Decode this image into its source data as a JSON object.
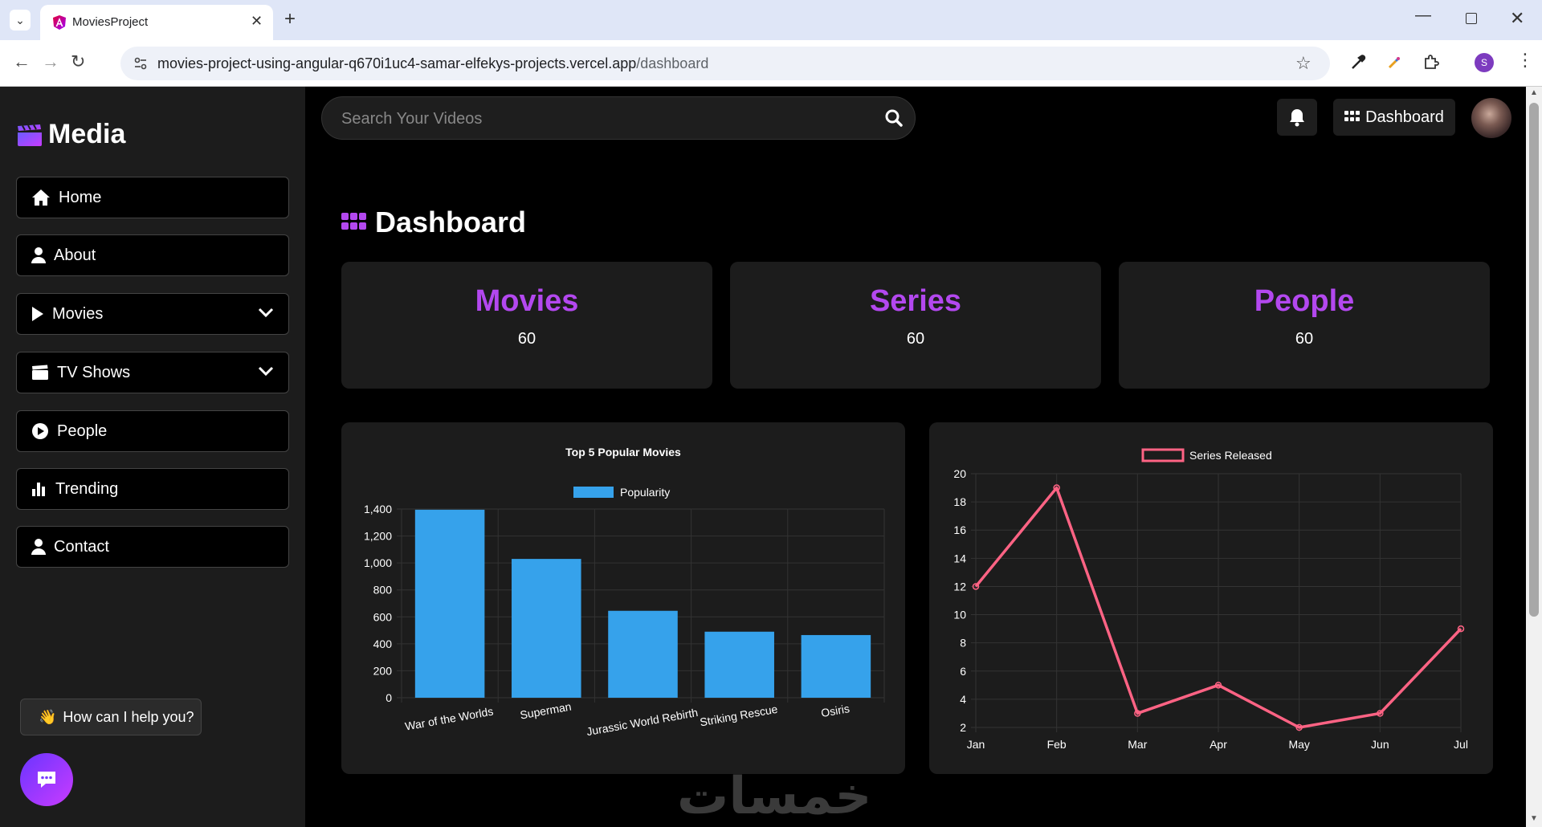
{
  "browser": {
    "tab_title": "MoviesProject",
    "url_host": "movies-project-using-angular-q670i1uc4-samar-elfekys-projects.vercel.app",
    "url_path": "/dashboard",
    "profile_initial": "S"
  },
  "sidebar": {
    "brand": "Media",
    "items": [
      {
        "label": "Home",
        "icon": "home-icon"
      },
      {
        "label": "About",
        "icon": "user-icon"
      },
      {
        "label": "Movies",
        "icon": "play-icon",
        "dropdown": true
      },
      {
        "label": "TV Shows",
        "icon": "clapperboard-icon",
        "dropdown": true
      },
      {
        "label": "People",
        "icon": "play-circle-icon"
      },
      {
        "label": "Trending",
        "icon": "bar-chart-icon"
      },
      {
        "label": "Contact",
        "icon": "user-icon"
      }
    ],
    "help_text": "How can I help you?",
    "help_emoji": "👋"
  },
  "header": {
    "search_placeholder": "Search Your Videos",
    "dashboard_label": "Dashboard"
  },
  "page": {
    "title": "Dashboard"
  },
  "stats": [
    {
      "label": "Movies",
      "value": "60"
    },
    {
      "label": "Series",
      "value": "60"
    },
    {
      "label": "People",
      "value": "60"
    }
  ],
  "colors": {
    "accent": "#b348ef",
    "bar": "#36a2eb",
    "line": "#ff6384"
  },
  "chart_data": [
    {
      "type": "bar",
      "title": "Top 5 Popular Movies",
      "categories": [
        "War of the Worlds",
        "Superman",
        "Jurassic World Rebirth",
        "Striking Rescue",
        "Osiris"
      ],
      "series": [
        {
          "name": "Popularity",
          "values": [
            1395,
            1030,
            645,
            490,
            465
          ]
        }
      ],
      "ylim": [
        0,
        1400
      ],
      "yticks": [
        "0",
        "200",
        "400",
        "600",
        "800",
        "1,000",
        "1,200",
        "1,400"
      ],
      "legend": "top",
      "grid": true
    },
    {
      "type": "line",
      "x": [
        "Jan",
        "Feb",
        "Mar",
        "Apr",
        "May",
        "Jun",
        "Jul"
      ],
      "series": [
        {
          "name": "Series Released",
          "values": [
            12,
            19,
            3,
            5,
            2,
            3,
            9
          ]
        }
      ],
      "ylim": [
        2,
        20
      ],
      "yticks": [
        "2",
        "4",
        "6",
        "8",
        "10",
        "12",
        "14",
        "16",
        "18",
        "20"
      ],
      "legend": "top",
      "grid": true
    }
  ],
  "watermark": "خمسات"
}
